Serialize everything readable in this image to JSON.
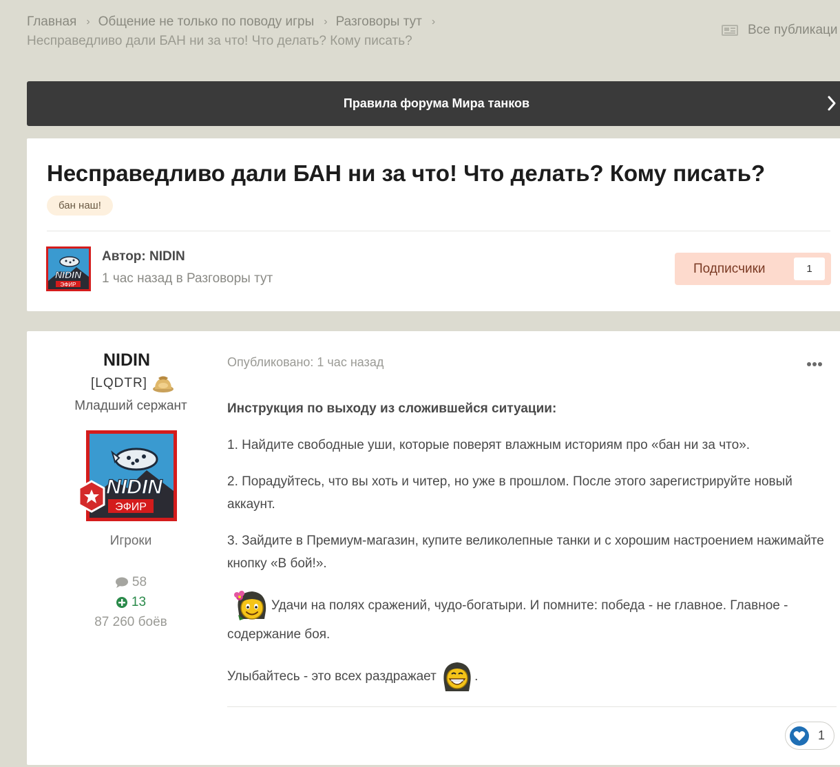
{
  "breadcrumb": {
    "items": [
      "Главная",
      "Общение не только по поводу игры",
      "Разговоры тут"
    ],
    "current": "Несправедливо дали БАН ни за что! Что делать? Кому писать?",
    "all_publications": "Все публикаци"
  },
  "rules_banner": {
    "label": "Правила форума Мира танков"
  },
  "topic": {
    "title": "Несправедливо дали БАН ни за что! Что делать? Кому писать?",
    "tag": "бан наш!",
    "author_label": "Автор: NIDIN",
    "meta": "1 час назад в Разговоры тут",
    "subscribe_label": "Подписчики",
    "subscribe_count": "1"
  },
  "post": {
    "user": {
      "name": "NIDIN",
      "clan": "[LQDTR]",
      "rank": "Младший сержант",
      "avatar_text": "NIDIN",
      "avatar_badge": "ЭФИР",
      "group": "Игроки",
      "posts": "58",
      "reputation": "13",
      "battles": "87 260 боёв"
    },
    "posted": "Опубликовано: 1 час назад",
    "heading": "Инструкция по выходу из сложившейся ситуации:",
    "p1": "1. Найдите свободные уши, которые поверят влажным историям про «бан ни за что».",
    "p2": "2. Порадуйтесь, что вы хоть и читер, но уже в прошлом. После этого зарегистрируйте новый аккаунт.",
    "p3": "3. Зайдите в Премиум-магазин, купите великолепные танки и с хорошим настроением нажимайте кнопку «В бой!».",
    "p4": "Удачи на полях сражений, чудо-богатыри. И помните: победа - не главное. Главное - содержание боя.",
    "p5": " Улыбайтесь - это всех раздражает",
    "p5_end": ".",
    "likes": "1"
  },
  "colors": {
    "background": "#dcdbd0",
    "banner": "#3a3a3a",
    "subscribe_bg": "#fddacd",
    "tag_bg": "#fdf0de",
    "reputation": "#2a8a4a",
    "like": "#1f6fb5"
  }
}
